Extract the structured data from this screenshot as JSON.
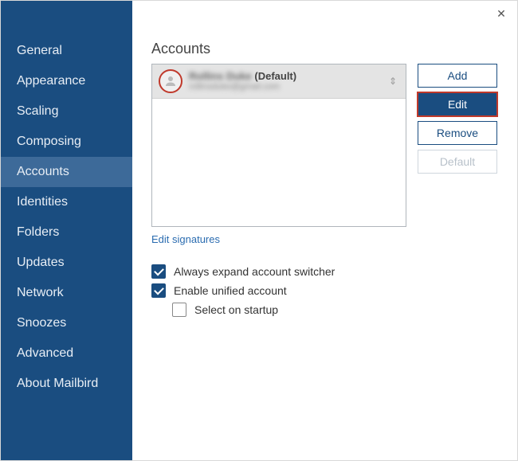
{
  "sidebar": {
    "items": [
      {
        "label": "General"
      },
      {
        "label": "Appearance"
      },
      {
        "label": "Scaling"
      },
      {
        "label": "Composing"
      },
      {
        "label": "Accounts"
      },
      {
        "label": "Identities"
      },
      {
        "label": "Folders"
      },
      {
        "label": "Updates"
      },
      {
        "label": "Network"
      },
      {
        "label": "Snoozes"
      },
      {
        "label": "Advanced"
      },
      {
        "label": "About Mailbird"
      }
    ],
    "selected_index": 4
  },
  "page": {
    "title": "Accounts",
    "edit_signatures": "Edit signatures"
  },
  "accounts": [
    {
      "name_obscured": "Rollins Duke",
      "default_suffix": "(Default)",
      "email_obscured": "rollinsduke@gmail.com"
    }
  ],
  "buttons": {
    "add": "Add",
    "edit": "Edit",
    "remove": "Remove",
    "default": "Default"
  },
  "options": {
    "always_expand": {
      "label": "Always expand account switcher",
      "checked": true
    },
    "enable_unified": {
      "label": "Enable unified account",
      "checked": true
    },
    "select_on_startup": {
      "label": "Select on startup",
      "checked": false
    }
  }
}
